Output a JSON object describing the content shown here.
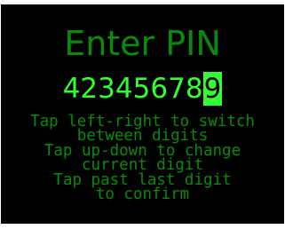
{
  "screen": {
    "title": "Enter PIN",
    "pin_digits": [
      "4",
      "2",
      "3",
      "4",
      "5",
      "6",
      "7",
      "8",
      "9"
    ],
    "active_digit_index": 8,
    "instructions": [
      "Tap left-right to switch",
      "between digits",
      "Tap up-down to change",
      "current digit",
      "Tap past last digit",
      "to confirm"
    ]
  },
  "colors": {
    "background": "#000000",
    "frame": "#ffffff",
    "title_text": "#0a8a0a",
    "pin_text": "#33ff33",
    "instruction_text": "#0a8a0a"
  }
}
